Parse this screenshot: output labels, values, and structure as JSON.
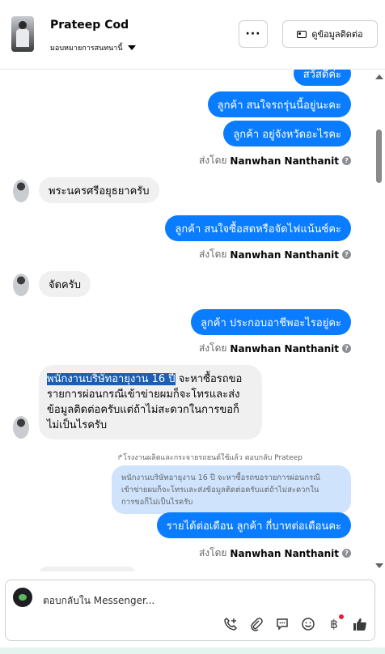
{
  "header": {
    "contact_name": "Prateep Cod",
    "assign_label": "มอบหมายการสนทนานี้",
    "more_label": "···",
    "contact_info_label": "ดูข้อมูลติดต่อ"
  },
  "messages": [
    {
      "dir": "out",
      "text": "สวัสดีค่ะ"
    },
    {
      "dir": "out",
      "text": "ลูกค้า สนใจรถรุ่นนี้อยู่นะคะ"
    },
    {
      "dir": "out",
      "text": "ลูกค้า อยู่จังหวัดอะไรคะ"
    },
    {
      "dir": "meta",
      "prefix": "ส่งโดย",
      "name": "Nanwhan Nanthanit"
    },
    {
      "dir": "in",
      "text": "พระนครศรีอยุธยาครับ"
    },
    {
      "dir": "out",
      "text": "ลูกค้า สนใจซื้อสดหรือจัดไฟแน้นซ์คะ"
    },
    {
      "dir": "meta",
      "prefix": "ส่งโดย",
      "name": "Nanwhan Nanthanit"
    },
    {
      "dir": "in",
      "text": "จัดครับ"
    },
    {
      "dir": "out",
      "text": "ลูกค้า ประกอบอาชีพอะไรอยู่คะ"
    },
    {
      "dir": "meta",
      "prefix": "ส่งโดย",
      "name": "Nanwhan Nanthanit"
    },
    {
      "dir": "in",
      "highlight": "พนักงานบริษัทอายุงาน 16 ปี",
      "lines": [
        " จะหาซื้อรถขอ",
        "รายการผ่อนกรณีเข้าข่ายผมก็จะโทรและส่ง",
        "ข้อมูลติดต่อครับแต่ถ้าไม่สะดวกในการขอก็",
        "ไม่เป็นไรครับ"
      ]
    },
    {
      "dir": "reply_note",
      "text": "↱โรงงานผลิตและกระจายรถยนต์ใช้แล้ว ตอบกลับ Prateep"
    },
    {
      "dir": "quoted",
      "lines": [
        "พนักงานบริษัทอายุงาน 16 ปี จะหาซื้อรถขอรายการผ่อนกรณี",
        "เข้าข่ายผมก็จะโทรและส่งข้อมูลติดต่อครับแต่ถ้าไม่สะดวกใน",
        "การขอก็ไม่เป็นไรครับ"
      ]
    },
    {
      "dir": "out",
      "text": "รายได้ต่อเดือน  ลูกค้า กี่บาทต่อเดือนคะ"
    },
    {
      "dir": "meta",
      "prefix": "ส่งโดย",
      "name": "Nanwhan Nanthanit"
    }
  ],
  "composer": {
    "placeholder": "ตอบกลับใน Messenger...",
    "tools": [
      "call-add-icon",
      "attach-icon",
      "chat-bubble-icon",
      "emoji-icon",
      "baht-icon",
      "like-icon"
    ]
  },
  "colors": {
    "outgoing": "#0a7cff",
    "incoming": "#f0f0f0",
    "quoted": "#cfe3fd"
  }
}
